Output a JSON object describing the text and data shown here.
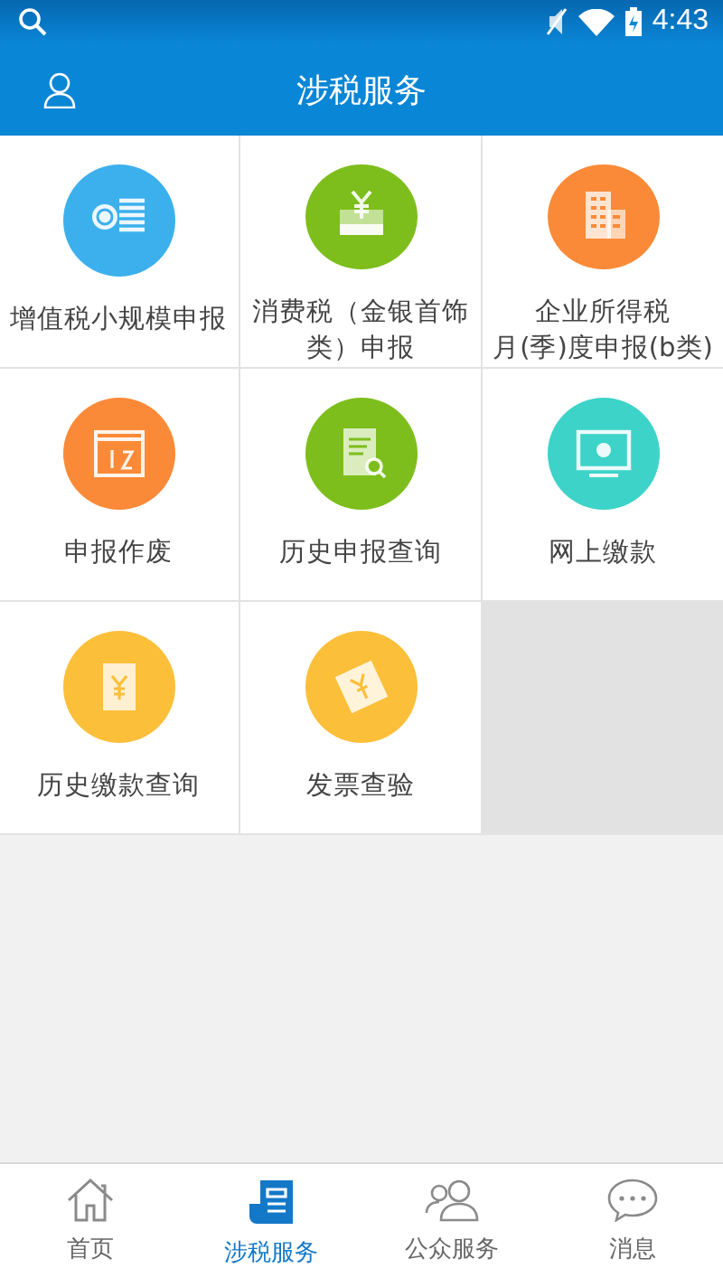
{
  "status_bar": {
    "time": "4:43"
  },
  "header": {
    "title": "涉税服务"
  },
  "services": [
    {
      "lines": [
        "增值税小规模申报"
      ],
      "color": "#3cb0ec"
    },
    {
      "lines": [
        "消费税（金银首饰",
        "类）申报"
      ],
      "color": "#7dbe1c"
    },
    {
      "lines": [
        "企业所得税",
        "月(季)度申报(b类)"
      ],
      "color": "#fa8a38"
    },
    {
      "lines": [
        "申报作废"
      ],
      "color": "#fa8a38"
    },
    {
      "lines": [
        "历史申报查询"
      ],
      "color": "#7dbe1c"
    },
    {
      "lines": [
        "网上缴款"
      ],
      "color": "#3dd3c8"
    },
    {
      "lines": [
        "历史缴款查询"
      ],
      "color": "#fcbf3a"
    },
    {
      "lines": [
        "发票查验"
      ],
      "color": "#fcbf3a"
    }
  ],
  "tabs": [
    {
      "label": "首页",
      "selected": false
    },
    {
      "label": "涉税服务",
      "selected": true
    },
    {
      "label": "公众服务",
      "selected": false
    },
    {
      "label": "消息",
      "selected": false
    }
  ]
}
